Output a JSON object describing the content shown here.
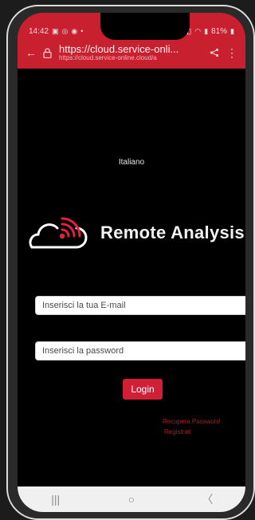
{
  "status_bar": {
    "time": "14:42",
    "battery": "81%"
  },
  "browser": {
    "url_main": "https://cloud.service-onli...",
    "url_sub": "https://cloud.service-online.cloud/a",
    "back_icon": "back-arrow-icon",
    "lock_icon": "lock-icon",
    "share_icon": "share-icon",
    "menu_icon": "kebab-menu-icon"
  },
  "page": {
    "language": "Italiano",
    "brand_name": "Remote Analysis",
    "email_placeholder": "Inserisci la tua E-mail",
    "password_placeholder": "Inserisci la password",
    "login_label": "Login",
    "recover_password": "Recupera Password",
    "register": "Registrati"
  },
  "colors": {
    "accent": "#c8202f",
    "button": "#d11f36",
    "link": "#b11a2a",
    "background": "#000000"
  }
}
